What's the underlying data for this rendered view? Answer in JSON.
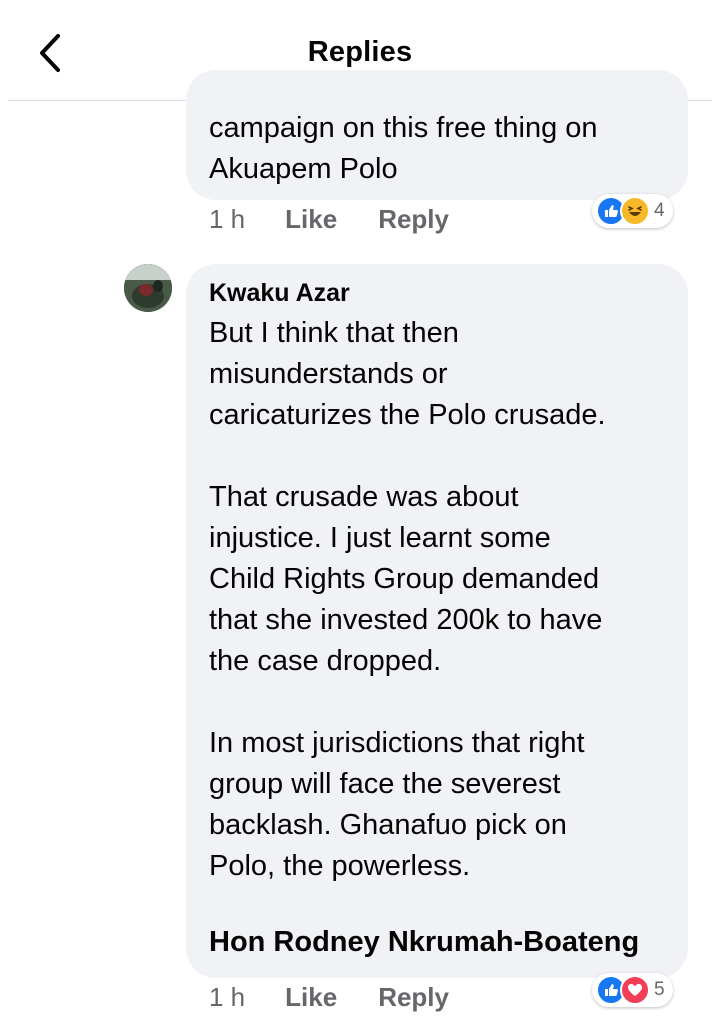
{
  "header": {
    "title": "Replies",
    "back_icon": "chevron-left-icon"
  },
  "comment1": {
    "text": "campaign on this free thing on\nAkuapem Polo",
    "time": "1 h",
    "like_label": "Like",
    "reply_label": "Reply",
    "reactions": [
      "like",
      "haha"
    ],
    "reaction_count": "4"
  },
  "comment2": {
    "author": "Kwaku Azar",
    "text": "But I think that then\nmisunderstands or\ncaricaturizes the Polo crusade.\n\nThat crusade was about\ninjustice. I just learnt some\nChild Rights Group demanded\nthat she invested 200k to have\nthe case dropped.\n\nIn most jurisdictions that right\ngroup will face the severest\nbacklash. Ghanafuo pick on\nPolo, the powerless.",
    "mention": "Hon Rodney Nkrumah-Boateng",
    "time": "1 h",
    "like_label": "Like",
    "reply_label": "Reply",
    "reactions": [
      "like",
      "love"
    ],
    "reaction_count": "5"
  },
  "colors": {
    "bubble": "#f0f2f5",
    "meta_text": "#65676b",
    "like_blue": "#1877f2",
    "haha_yellow": "#f7b928",
    "love_red": "#f33e58"
  }
}
